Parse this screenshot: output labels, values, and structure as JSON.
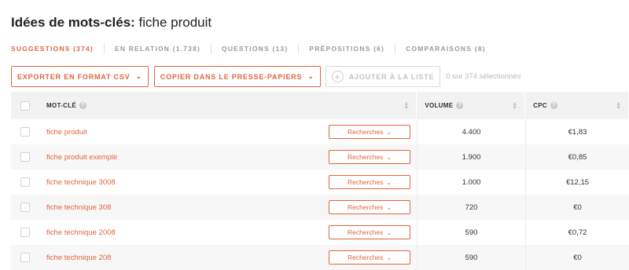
{
  "title": {
    "bold": "Idées de mots-clés:",
    "query": "fiche produit"
  },
  "tabs": [
    {
      "label": "SUGGESTIONS (374)",
      "active": true
    },
    {
      "label": "EN RELATION (1.738)",
      "active": false
    },
    {
      "label": "QUESTIONS (13)",
      "active": false
    },
    {
      "label": "PRÉPOSITIONS (6)",
      "active": false
    },
    {
      "label": "COMPARAISONS (8)",
      "active": false
    }
  ],
  "toolbar": {
    "export_label": "EXPORTER EN FORMAT CSV",
    "copy_label": "COPIER DANS LE PRESSE-PAPIERS",
    "add_label": "AJOUTER À LA LISTE",
    "selection_text": "0 sur 374 sélectionnés"
  },
  "table": {
    "headers": {
      "keyword": "MOT-CLÉ",
      "volume": "VOLUME",
      "cpc": "CPC"
    },
    "search_label": "Recherches",
    "rows": [
      {
        "keyword": "fiche produit",
        "volume": "4.400",
        "cpc": "€1,83"
      },
      {
        "keyword": "fiche produit exemple",
        "volume": "1.900",
        "cpc": "€0,85"
      },
      {
        "keyword": "fiche technique 3008",
        "volume": "1.000",
        "cpc": "€12,15"
      },
      {
        "keyword": "fiche technique 308",
        "volume": "720",
        "cpc": "€0"
      },
      {
        "keyword": "fiche technique 2008",
        "volume": "590",
        "cpc": "€0,72"
      },
      {
        "keyword": "fiche technique 208",
        "volume": "590",
        "cpc": "€0"
      }
    ]
  },
  "colors": {
    "accent": "#e0653e",
    "header_bg": "#f2f2f2",
    "muted": "#9a9a9a"
  },
  "icons": {
    "dropdown": "chevron-down-icon",
    "add": "plus-circle-icon",
    "help": "help-icon",
    "sort": "sort-icon"
  }
}
